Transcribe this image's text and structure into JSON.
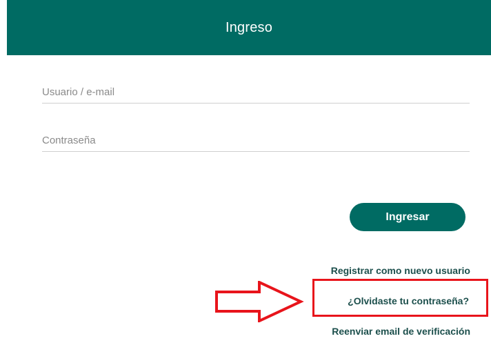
{
  "header": {
    "title": "Ingreso"
  },
  "form": {
    "username_placeholder": "Usuario / e-mail",
    "username_value": "",
    "password_placeholder": "Contraseña",
    "password_value": "",
    "submit_label": "Ingresar"
  },
  "links": {
    "register": "Registrar como nuevo usuario",
    "forgot_password": "¿Olvidaste tu contraseña?",
    "resend_verification": "Reenviar email de verificación"
  },
  "colors": {
    "brand": "#006b63",
    "annotation": "#e8141b",
    "link": "#1c4f4c"
  },
  "annotation": {
    "arrow_icon": "right-arrow-icon",
    "highlight": "highlight-box"
  }
}
